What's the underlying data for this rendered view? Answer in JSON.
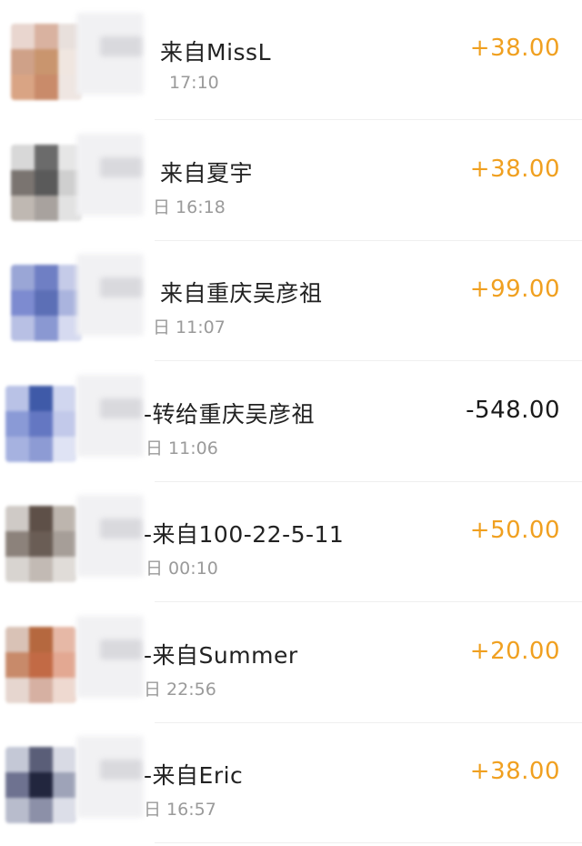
{
  "colors": {
    "income": "#f0a020",
    "expense": "#1a1a1a",
    "title": "#222222",
    "time": "#9a9a9a"
  },
  "transactions": [
    {
      "title": "来自MissL",
      "time_visible": "17:10",
      "amount": "+38.00",
      "direction": "income",
      "avatar_icon": "blurred-avatar-icon",
      "avatar_colors": [
        "#e9d6cf",
        "#d9b2a0",
        "#e8e0dc",
        "#cfa188",
        "#c9956e",
        "#f0e6e0",
        "#d9a484",
        "#c98b6a",
        "#efe6e2"
      ]
    },
    {
      "title": "来自夏宇",
      "time_visible": "日 16:18",
      "amount": "+38.00",
      "direction": "income",
      "avatar_icon": "blurred-avatar-icon",
      "avatar_colors": [
        "#d8d8d8",
        "#6b6b6b",
        "#e6e6e6",
        "#7a7470",
        "#5a5a5a",
        "#cfcfcf",
        "#bfb8b2",
        "#a8a29e",
        "#e2e2e2"
      ]
    },
    {
      "title": "来自重庆吴彦祖",
      "time_visible": "日 11:07",
      "amount": "+99.00",
      "direction": "income",
      "avatar_icon": "blurred-avatar-icon",
      "avatar_colors": [
        "#9aa6d6",
        "#6f7fc4",
        "#c5cbe8",
        "#7d8bd0",
        "#5c6fb6",
        "#aab4de",
        "#b8c0e4",
        "#8a98d2",
        "#d6daf0"
      ]
    },
    {
      "title": "-转给重庆吴彦祖",
      "time_visible": "日 11:06",
      "amount": "-548.00",
      "direction": "expense",
      "avatar_icon": "blurred-avatar-icon",
      "avatar_colors": [
        "#b9c2e6",
        "#3f5aa8",
        "#d0d6ef",
        "#8a9ad6",
        "#6477c2",
        "#c2c9ea",
        "#a6b2e0",
        "#8d9bd4",
        "#dfe3f4"
      ]
    },
    {
      "title": "-来自100-22-5-11",
      "time_visible": "日 00:10",
      "amount": "+50.00",
      "direction": "income",
      "avatar_icon": "blurred-avatar-icon",
      "avatar_colors": [
        "#cfcac6",
        "#5e5048",
        "#bdb5ae",
        "#8c827b",
        "#6a5d55",
        "#a69e98",
        "#d8d4d0",
        "#c2bab4",
        "#e0dcd8"
      ]
    },
    {
      "title": "-来自Summer",
      "time_visible": "日 22:56",
      "amount": "+20.00",
      "direction": "income",
      "avatar_icon": "blurred-avatar-icon",
      "avatar_colors": [
        "#d9c2b6",
        "#b5683f",
        "#e6b8a6",
        "#c88a6a",
        "#c26a45",
        "#e3a892",
        "#e6d6cf",
        "#d6b0a2",
        "#eed9d0"
      ]
    },
    {
      "title": "-来自Eric",
      "time_visible": "日 16:57",
      "amount": "+38.00",
      "direction": "income",
      "avatar_icon": "blurred-avatar-icon",
      "avatar_colors": [
        "#c4c8d6",
        "#5a5e78",
        "#d8dae4",
        "#6e7290",
        "#22263e",
        "#9ea3b8",
        "#b8bccc",
        "#8c90a8",
        "#dcdee8"
      ]
    }
  ]
}
